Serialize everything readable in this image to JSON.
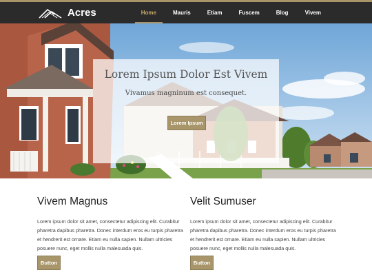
{
  "site": {
    "brand": "Acres"
  },
  "nav": {
    "items": [
      {
        "label": "Home",
        "active": true
      },
      {
        "label": "Mauris",
        "active": false
      },
      {
        "label": "Etiam",
        "active": false
      },
      {
        "label": "Fuscem",
        "active": false
      },
      {
        "label": "Blog",
        "active": false
      },
      {
        "label": "Vivem",
        "active": false
      }
    ]
  },
  "hero": {
    "title": "Lorem Ipsum Dolor Est Vivem",
    "subtitle": "Vivamus magninum est consequet.",
    "button_label": "Lorem Ipsum"
  },
  "columns": [
    {
      "heading": "Vivem Magnus",
      "body": "Lorem ipsum dolor sit amet, consectetur adipiscing elit. Curabitur pharetra dapibus pharetra. Donec interdum eros eu turpis pharetra et hendrerit est ornare. Etiam eu nulla sapien. Nullam ultricies posuere nunc, eget mollis nulla malesuada quis.",
      "button_label": "Button"
    },
    {
      "heading": "Velit Sumuser",
      "body": "Lorem ipsum dolor sit amet, consectetur adipiscing elit. Curabitur pharetra dapibus pharetra. Donec interdum eros eu turpis pharetra et hendrerit est ornare. Etiam eu nulla sapien. Nullam ultricies posuere nunc, eget mollis nulla malesuada quis.",
      "button_label": "Button"
    }
  ],
  "colors": {
    "accent": "#a8966a",
    "nav_bg": "#2b2b2b",
    "active_link": "#c8a96a"
  },
  "icons": {
    "logo": "house-roof-logo-icon"
  }
}
